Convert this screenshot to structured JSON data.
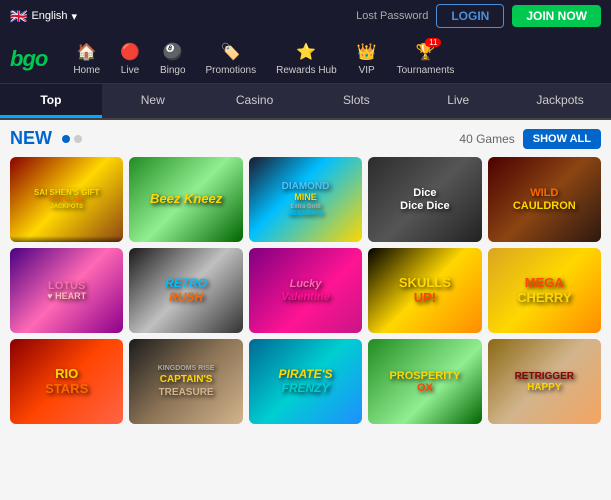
{
  "header": {
    "lang": "English",
    "lost_password": "Lost Password",
    "login_label": "LOGIN",
    "join_label": "JOIN NOW"
  },
  "nav": {
    "logo": "bgo",
    "items": [
      {
        "label": "Home",
        "icon": "🏠"
      },
      {
        "label": "Live",
        "icon": "🔴"
      },
      {
        "label": "Bingo",
        "icon": "🎱"
      },
      {
        "label": "Promotions",
        "icon": "🏷️"
      },
      {
        "label": "Rewards Hub",
        "icon": "⭐"
      },
      {
        "label": "VIP",
        "icon": "👑"
      },
      {
        "label": "Tournaments",
        "icon": "🏆",
        "badge": "11"
      }
    ]
  },
  "category_tabs": [
    {
      "label": "Top",
      "active": true
    },
    {
      "label": "New",
      "active": false
    },
    {
      "label": "Casino",
      "active": false
    },
    {
      "label": "Slots",
      "active": false
    },
    {
      "label": "Live",
      "active": false
    },
    {
      "label": "Jackpots",
      "active": false
    }
  ],
  "section": {
    "title": "NEW",
    "games_count": "40 Games",
    "show_all": "SHOW ALL"
  },
  "games": [
    {
      "name": "Sai Shen's Gift Fire Blaze Jackpots",
      "class": "g1",
      "deco": "SAI SHEN'S GIFT"
    },
    {
      "name": "Beez Kneez",
      "class": "g2",
      "deco": "Beez Kneez"
    },
    {
      "name": "Diamond Mine Extra Gold Megaways",
      "class": "g3",
      "deco": "DIAMOND MINE"
    },
    {
      "name": "Dice Dice Dice",
      "class": "g4",
      "deco": "Dice Dice Dice"
    },
    {
      "name": "Wild Cauldron",
      "class": "g5",
      "deco": "WILD CAULDRON"
    },
    {
      "name": "Lotus Heart",
      "class": "g6",
      "deco": "LOTUS♥HEART"
    },
    {
      "name": "Retro Rush",
      "class": "g7",
      "deco": "RETRO RUSH"
    },
    {
      "name": "Lucky Valentine",
      "class": "g8",
      "deco": "Lucky Valentine"
    },
    {
      "name": "Skulls Up!",
      "class": "g9",
      "deco": "SKULLS UP!"
    },
    {
      "name": "Mega Cherry",
      "class": "g10",
      "deco": "MEGA CHERRY"
    },
    {
      "name": "Rio Stars",
      "class": "g11",
      "deco": "RIO STARS"
    },
    {
      "name": "Captain's Treasure",
      "class": "g12",
      "deco": "CAPTAIN'S TREASURE"
    },
    {
      "name": "Pirate's Frenzy",
      "class": "g13",
      "deco": "PIRATE'S FRENZY"
    },
    {
      "name": "Prosperity Ox",
      "class": "g14",
      "deco": "PROSPERITY OX"
    },
    {
      "name": "Retrigger Happy",
      "class": "g15",
      "deco": "RETRIGGER HAPPY"
    }
  ]
}
